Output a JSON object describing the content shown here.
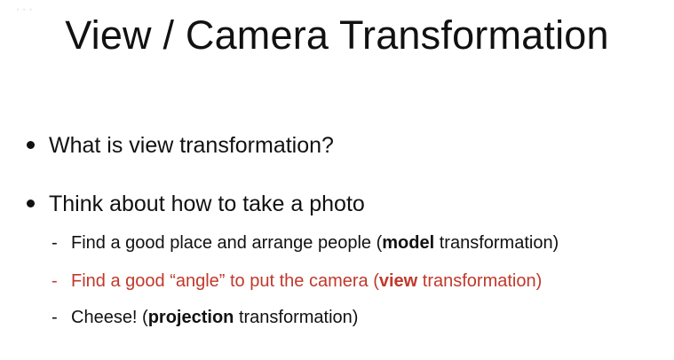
{
  "watermark": "...",
  "slide": {
    "title": "View / Camera Transformation",
    "bullets": [
      {
        "text": "What is view transformation?"
      },
      {
        "text": "Think about how to take a photo"
      }
    ],
    "subitems": [
      {
        "dash": "-",
        "before": "Find a good place and arrange people (",
        "bold": "model",
        "after": " transformation)",
        "color": "#111111"
      },
      {
        "dash": "-",
        "before": "Find a good “angle” to put the camera (",
        "bold": "view",
        "after": " transformation)",
        "color": "#c0392b"
      },
      {
        "dash": "-",
        "before": "Cheese! (",
        "bold": "projection",
        "after": " transformation)",
        "color": "#111111"
      }
    ]
  }
}
